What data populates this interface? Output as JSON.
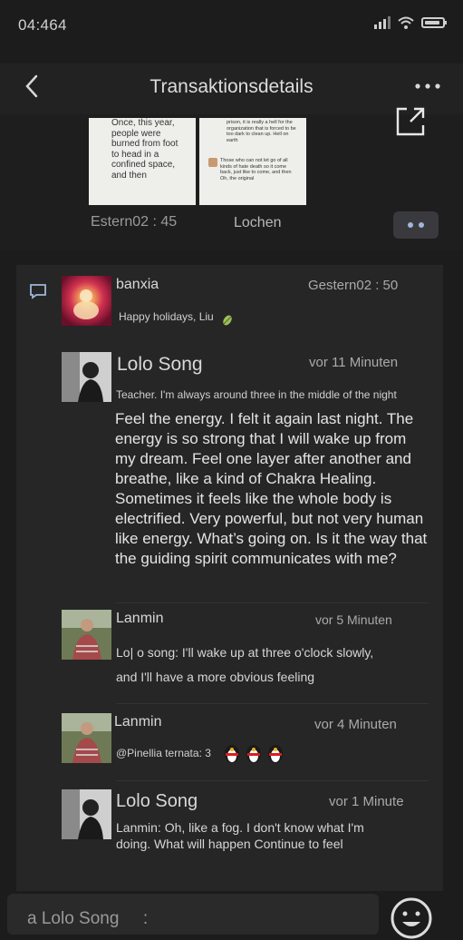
{
  "status": {
    "time": "04:464"
  },
  "header": {
    "title": "Transaktionsdetails"
  },
  "preview": {
    "thumb1_text": "Once, this year, people were burned from foot to head in a confined space, and then",
    "thumb2_text_top": "prison, it is really a hell for the organization that is forced to be too dark to clean up. Hell on earth",
    "thumb2_text_bottom": "Those who can not let go of all kinds of hate death so it come back, just like to come, and then Oh, the original",
    "time": "Estern02 : 45",
    "delete_label": "Lochen"
  },
  "comments": [
    {
      "name": "banxia",
      "time": "Gestern02 : 50",
      "text": "Happy holidays, Liu"
    },
    {
      "name": "Lolo Song",
      "time": "vor 11 Minuten",
      "reply_to": "Teacher. I'm always around three in the middle of the night",
      "text": "Feel the energy. I felt it again last night. The energy is so strong that I will wake up from my dream. Feel one layer after another and breathe, like a kind of Chakra Healing. Sometimes it feels like the whole body is electrified. Very powerful, but not very human like energy. What’s going on. Is it the way that the guiding spirit communicates with me?"
    },
    {
      "name": "Lanmin",
      "time": "vor 5 Minuten",
      "text_line1": "Lo| o song: I'll wake up at three o'clock slowly,",
      "text_line2": "and I'll have a more obvious feeling"
    },
    {
      "name": "Lanmin",
      "time": "vor 4 Minuten",
      "text": "@Pinellia ternata: 3"
    },
    {
      "name": "Lolo Song",
      "time": "vor 1 Minute",
      "text": "Lanmin: Oh, like a fog. I don't know what I'm doing. What will happen Continue to feel"
    }
  ],
  "input": {
    "placeholder": "a Lolo Song     :"
  },
  "colors": {
    "background": "#1c1c1c",
    "panel": "#262626",
    "accent": "#9fb7d8"
  }
}
